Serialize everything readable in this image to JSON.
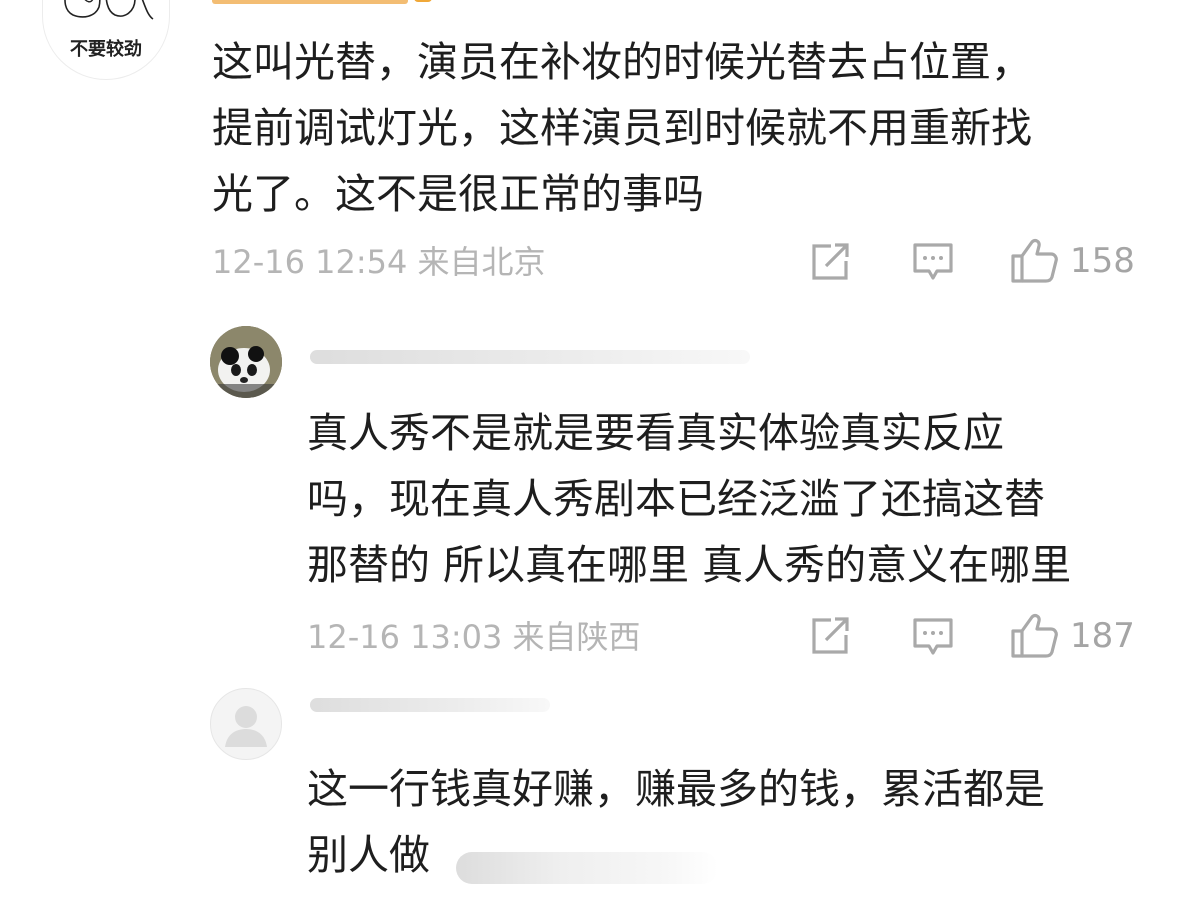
{
  "comments": [
    {
      "avatar_caption": "不要较劲",
      "lines": [
        "这叫光替，演员在补妆的时候光替去占位置，",
        "提前调试灯光，这样演员到时候就不用重新找",
        "光了。这不是很正常的事吗"
      ],
      "time": "12-16 12:54",
      "location": "来自北京",
      "likes": "158"
    },
    {
      "lines": [
        "真人秀不是就是要看真实体验真实反应",
        "吗，现在真人秀剧本已经泛滥了还搞这替",
        "那替的 所以真在哪里 真人秀的意义在哪里"
      ],
      "time": "12-16 13:03",
      "location": "来自陕西",
      "likes": "187"
    },
    {
      "lines": [
        "这一行钱真好赚，赚最多的钱，累活都是",
        "别人做"
      ]
    }
  ],
  "icons": {
    "share": "share-icon",
    "comment": "comment-icon",
    "like": "thumbs-up-icon"
  },
  "colors": {
    "meta_text": "#b5b5b5",
    "body_text": "#1e1e1e",
    "username_orange": "#f1b15a"
  }
}
